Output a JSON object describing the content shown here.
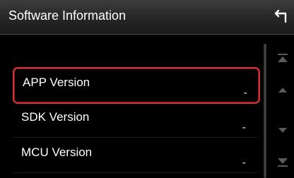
{
  "header": {
    "title": "Software Information"
  },
  "items": [
    {
      "label": "",
      "value": ""
    },
    {
      "label": "APP Version",
      "value": "-"
    },
    {
      "label": "SDK Version",
      "value": "-"
    },
    {
      "label": "MCU Version",
      "value": "-"
    }
  ],
  "icons": {
    "back": "back-arrow-icon",
    "scroll_top": "scroll-to-top-icon",
    "scroll_up": "scroll-up-icon",
    "scroll_down": "scroll-down-icon",
    "scroll_bottom": "scroll-to-bottom-icon"
  },
  "colors": {
    "selection_border": "#d3303a"
  }
}
